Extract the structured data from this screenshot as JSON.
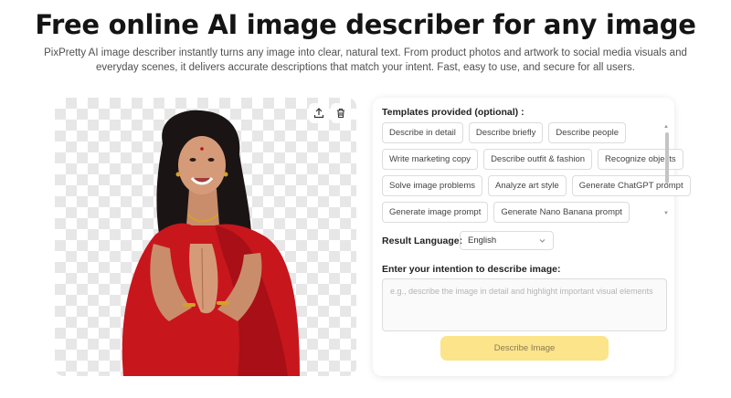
{
  "hero": {
    "title_highlight": "Free",
    "title_rest": " online AI image describer for any image",
    "subtitle": "PixPretty AI image describer instantly turns any image into clear, natural text. From product photos and artwork to social media visuals and everyday scenes, it delivers accurate descriptions that match your intent. Fast, easy to use, and secure for all users."
  },
  "image_panel": {
    "upload_icon": "upload-icon",
    "delete_icon": "trash-icon"
  },
  "form": {
    "templates_label": "Templates provided (optional) :",
    "templates": [
      [
        "Describe in detail",
        "Describe briefly",
        "Describe people"
      ],
      [
        "Write marketing copy",
        "Describe outfit & fashion",
        "Recognize objects"
      ],
      [
        "Solve image problems",
        "Analyze art style",
        "Generate ChatGPT prompt"
      ],
      [
        "Generate image prompt",
        "Generate Nano Banana prompt"
      ]
    ],
    "language_label": "Result Language:",
    "language_value": "English",
    "intention_label": "Enter your intention to describe image:",
    "intention_placeholder": "e.g., describe the image in detail and highlight important visual elements",
    "submit_label": "Describe Image"
  },
  "colors": {
    "highlight": "#f7e04b",
    "button_bg": "#fbe48a",
    "saree_red": "#c8161d"
  }
}
